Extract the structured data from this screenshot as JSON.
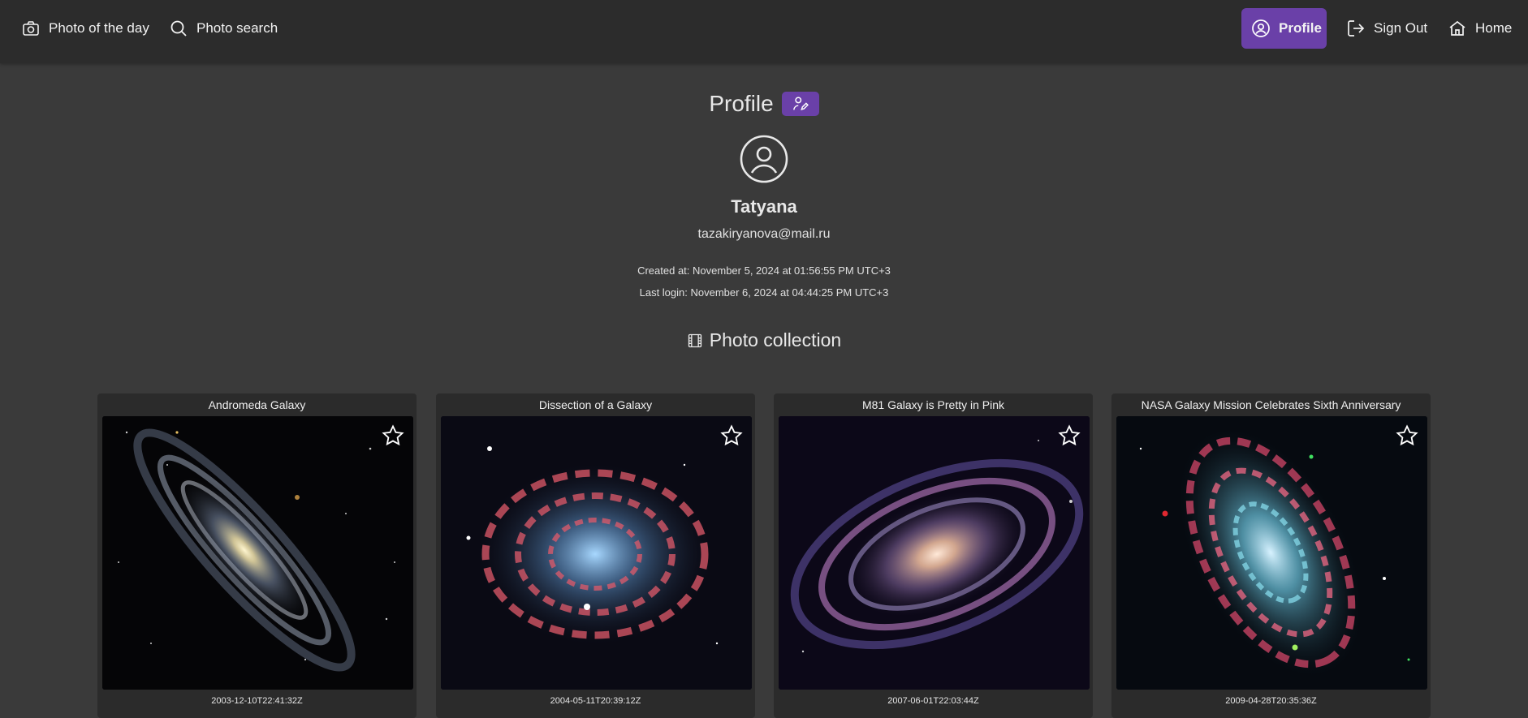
{
  "nav": {
    "photo_of_day": "Photo of the day",
    "photo_search": "Photo search",
    "profile": "Profile",
    "sign_out": "Sign Out",
    "home": "Home"
  },
  "profile": {
    "title": "Profile",
    "username": "Tatyana",
    "email": "tazakiryanova@mail.ru",
    "created": "Created at: November 5, 2024 at 01:56:55 PM UTC+3",
    "last_login": "Last login: November 6, 2024 at 04:44:25 PM UTC+3"
  },
  "collection": {
    "title": "Photo collection",
    "photos": [
      {
        "title": "Andromeda Galaxy",
        "date": "2003-12-10T22:41:32Z"
      },
      {
        "title": "Dissection of a Galaxy",
        "date": "2004-05-11T20:39:12Z"
      },
      {
        "title": "M81 Galaxy is Pretty in Pink",
        "date": "2007-06-01T22:03:44Z"
      },
      {
        "title": "NASA Galaxy Mission Celebrates Sixth Anniversary",
        "date": "2009-04-28T20:35:36Z"
      }
    ]
  },
  "colors": {
    "accent": "#6a40a8",
    "topbar": "#2c2c2c",
    "background": "#3a3a3a",
    "card": "#2b2b2b"
  },
  "icons": {
    "photo_of_day": "camera-icon",
    "photo_search": "search-icon",
    "profile": "user-circle-icon",
    "sign_out": "sign-out-icon",
    "home": "home-icon",
    "edit_profile": "user-edit-icon",
    "collection": "film-icon",
    "favorite": "star-icon"
  }
}
